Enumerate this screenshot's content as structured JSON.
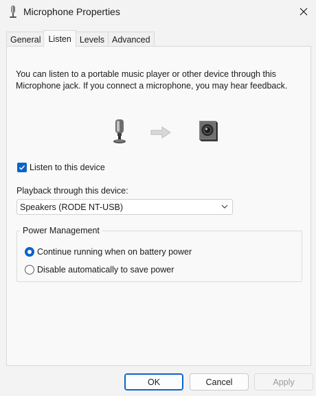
{
  "window": {
    "title": "Microphone Properties",
    "title_icon": "microphone-icon",
    "close_icon": "close-icon"
  },
  "tabs": [
    {
      "label": "General"
    },
    {
      "label": "Listen",
      "active": true
    },
    {
      "label": "Levels"
    },
    {
      "label": "Advanced"
    }
  ],
  "listen": {
    "description": "You can listen to a portable music player or other device through this Microphone jack.  If you connect a microphone, you may hear feedback.",
    "illustration": [
      "microphone-icon",
      "arrow-right-icon",
      "speaker-icon"
    ],
    "listen_checkbox_label": "Listen to this device",
    "listen_checked": true,
    "playback_label": "Playback through this device:",
    "playback_selected": "Speakers (RODE NT-USB)"
  },
  "power": {
    "group_label": "Power Management",
    "options": [
      {
        "label": "Continue running when on battery power",
        "selected": true
      },
      {
        "label": "Disable automatically to save power",
        "selected": false
      }
    ]
  },
  "buttons": {
    "ok": "OK",
    "cancel": "Cancel",
    "apply": "Apply"
  },
  "colors": {
    "accent": "#0a64c8",
    "background": "#f3f3f3",
    "panel": "#f9f9f9"
  }
}
